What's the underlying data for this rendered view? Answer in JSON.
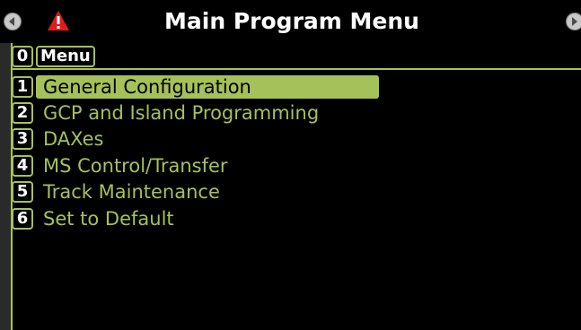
{
  "header": {
    "title": "Main Program Menu",
    "left_nav_icon": "nav-left-arrow-icon",
    "right_nav_icon": "nav-right-arrow-icon",
    "alarm_icon": "alarm-warning-icon"
  },
  "menu": {
    "key": "0",
    "label": "Menu"
  },
  "items": [
    {
      "key": "1",
      "label": "General Configuration",
      "selected": true
    },
    {
      "key": "2",
      "label": "GCP and Island Programming"
    },
    {
      "key": "3",
      "label": "DAXes"
    },
    {
      "key": "4",
      "label": "MS Control/Transfer"
    },
    {
      "key": "5",
      "label": "Track Maintenance"
    },
    {
      "key": "6",
      "label": "Set to Default"
    }
  ],
  "colors": {
    "accent": "#a4c15a",
    "background": "#000000",
    "title_text": "#ffffff",
    "alarm": "#e01b1b"
  }
}
